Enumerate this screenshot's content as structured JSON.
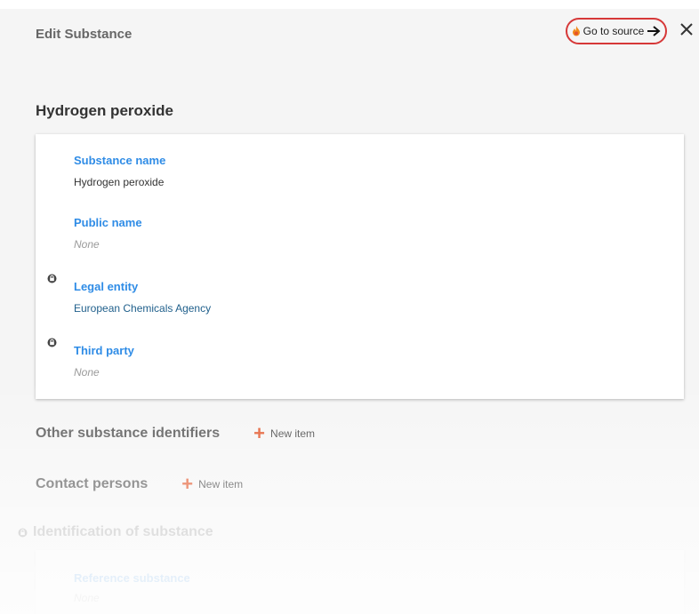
{
  "header": {
    "title": "Edit Substance",
    "source_link_label": "Go to source",
    "close_icon": "close-icon",
    "flame_icon": "flame-icon",
    "arrow_icon": "arrow-right-icon",
    "highlight_color": "#d63838"
  },
  "substance": {
    "title": "Hydrogen peroxide",
    "fields": [
      {
        "label": "Substance name",
        "value": "Hydrogen peroxide"
      },
      {
        "label": "Public name",
        "value": "None"
      },
      {
        "label": "Legal entity",
        "value": "European Chemicals Agency"
      },
      {
        "label": "Third party",
        "value": "None"
      }
    ]
  },
  "sections": {
    "other_identifiers": {
      "title": "Other substance identifiers",
      "new_item_label": "New item"
    },
    "contact_persons": {
      "title": "Contact persons",
      "new_item_label": "New item"
    },
    "identification": {
      "title": "Identification of substance",
      "field_label": "Reference substance",
      "field_value": "None"
    }
  },
  "colors": {
    "label_blue": "#2f8ce6",
    "link_blue": "#1f5f8b",
    "plus_orange": "#e2562a"
  }
}
